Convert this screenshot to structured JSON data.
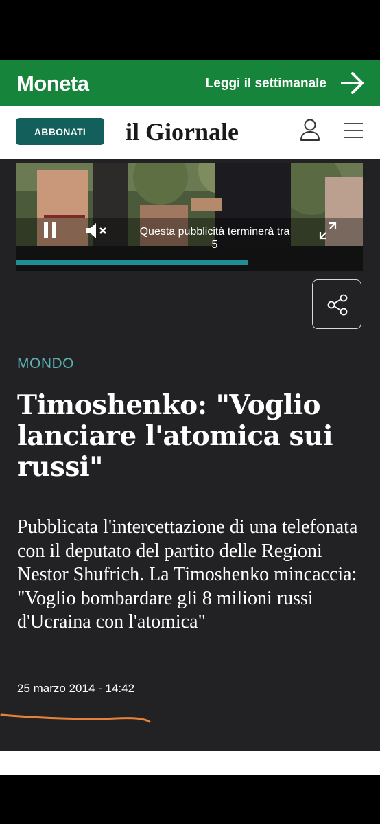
{
  "promo": {
    "brand": "Moneta",
    "cta": "Leggi il settimanale",
    "color": "#16843b"
  },
  "header": {
    "subscribe_label": "ABBONATI",
    "logo": "il Giornale"
  },
  "ad": {
    "message_line1": "Questa pubblicità terminerà tra",
    "countdown": "5",
    "progress": 0.67
  },
  "article": {
    "category": "MONDO",
    "title": "Timoshenko: \"Voglio lanciare l'atomica sui russi\"",
    "summary": "Pubblicata l'intercettazione di una telefonata con il deputato del partito delle Regioni Nestor Shufrich. La Timoshenko mincaccia: \"Voglio bombardare gli 8 milioni russi d'Ucraina con l'atomica\"",
    "date": "25 marzo 2014 - 14:42"
  }
}
